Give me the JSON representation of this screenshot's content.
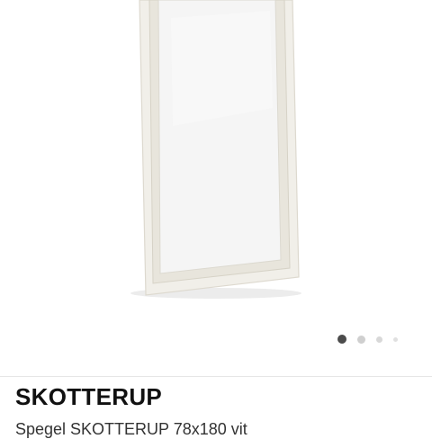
{
  "product": {
    "name": "SKOTTERUP",
    "description": "Spegel SKOTTERUP 78x180 vit"
  },
  "gallery": {
    "image_subject": "mirror-image",
    "image_count": 4,
    "active_index": 0
  },
  "colors": {
    "frame": "#f1efe9",
    "glass": "#f4f4f4",
    "active_dot": "#4b4b4b",
    "inactive_dot": "#cfcfcf"
  }
}
